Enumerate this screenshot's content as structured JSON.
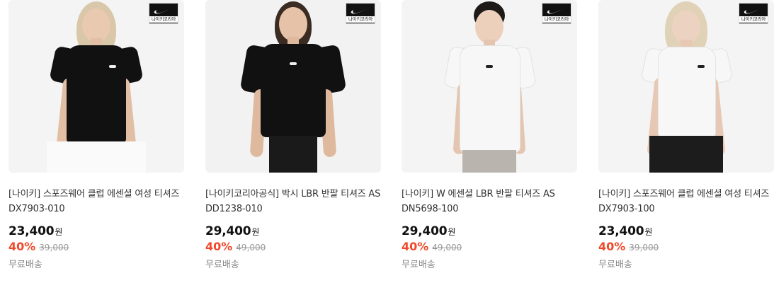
{
  "badge_text": "나이키코리아",
  "products": [
    {
      "title": "[나이키] 스포즈웨어 클럽 에센셜 여성 티셔즈 DX7903-010",
      "price": "23,400",
      "currency": "원",
      "discount": "40%",
      "original_price": "39,000",
      "shipping": "무료배송",
      "shirt_color": "#111111",
      "icon": "nike-swoosh-icon"
    },
    {
      "title": "[나이키코리아공식] 박시 LBR 반팔 티셔즈 AS DD1238-010",
      "price": "29,400",
      "currency": "원",
      "discount": "40%",
      "original_price": "49,000",
      "shipping": "무료배송",
      "shirt_color": "#111111",
      "icon": "nike-swoosh-icon"
    },
    {
      "title": "[나이키] W 에센셜 LBR 반팔 티셔즈 AS DN5698-100",
      "price": "29,400",
      "currency": "원",
      "discount": "40%",
      "original_price": "49,000",
      "shipping": "무료배송",
      "shirt_color": "#f7f7f7",
      "icon": "nike-swoosh-icon"
    },
    {
      "title": "[나이키] 스포즈웨어 클럽 에센셜 여성 티셔즈 DX7903-100",
      "price": "23,400",
      "currency": "원",
      "discount": "40%",
      "original_price": "39,000",
      "shipping": "무료배송",
      "shirt_color": "#f7f7f7",
      "icon": "nike-swoosh-icon"
    }
  ],
  "colors": {
    "discount": "#f04a2a",
    "price": "#111111",
    "muted": "#888888"
  }
}
